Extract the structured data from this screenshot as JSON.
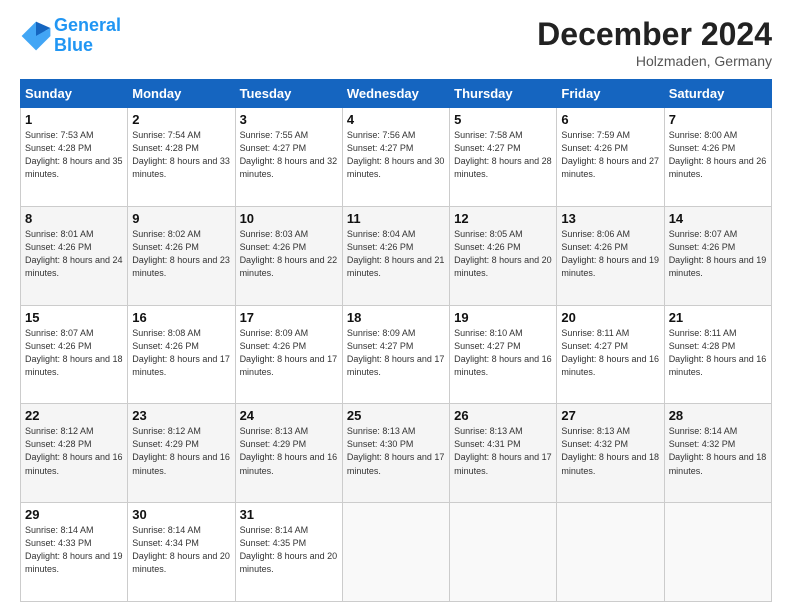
{
  "header": {
    "logo_line1": "General",
    "logo_line2": "Blue",
    "month": "December 2024",
    "location": "Holzmaden, Germany"
  },
  "weekdays": [
    "Sunday",
    "Monday",
    "Tuesday",
    "Wednesday",
    "Thursday",
    "Friday",
    "Saturday"
  ],
  "weeks": [
    [
      {
        "day": "1",
        "sunrise": "Sunrise: 7:53 AM",
        "sunset": "Sunset: 4:28 PM",
        "daylight": "Daylight: 8 hours and 35 minutes."
      },
      {
        "day": "2",
        "sunrise": "Sunrise: 7:54 AM",
        "sunset": "Sunset: 4:28 PM",
        "daylight": "Daylight: 8 hours and 33 minutes."
      },
      {
        "day": "3",
        "sunrise": "Sunrise: 7:55 AM",
        "sunset": "Sunset: 4:27 PM",
        "daylight": "Daylight: 8 hours and 32 minutes."
      },
      {
        "day": "4",
        "sunrise": "Sunrise: 7:56 AM",
        "sunset": "Sunset: 4:27 PM",
        "daylight": "Daylight: 8 hours and 30 minutes."
      },
      {
        "day": "5",
        "sunrise": "Sunrise: 7:58 AM",
        "sunset": "Sunset: 4:27 PM",
        "daylight": "Daylight: 8 hours and 28 minutes."
      },
      {
        "day": "6",
        "sunrise": "Sunrise: 7:59 AM",
        "sunset": "Sunset: 4:26 PM",
        "daylight": "Daylight: 8 hours and 27 minutes."
      },
      {
        "day": "7",
        "sunrise": "Sunrise: 8:00 AM",
        "sunset": "Sunset: 4:26 PM",
        "daylight": "Daylight: 8 hours and 26 minutes."
      }
    ],
    [
      {
        "day": "8",
        "sunrise": "Sunrise: 8:01 AM",
        "sunset": "Sunset: 4:26 PM",
        "daylight": "Daylight: 8 hours and 24 minutes."
      },
      {
        "day": "9",
        "sunrise": "Sunrise: 8:02 AM",
        "sunset": "Sunset: 4:26 PM",
        "daylight": "Daylight: 8 hours and 23 minutes."
      },
      {
        "day": "10",
        "sunrise": "Sunrise: 8:03 AM",
        "sunset": "Sunset: 4:26 PM",
        "daylight": "Daylight: 8 hours and 22 minutes."
      },
      {
        "day": "11",
        "sunrise": "Sunrise: 8:04 AM",
        "sunset": "Sunset: 4:26 PM",
        "daylight": "Daylight: 8 hours and 21 minutes."
      },
      {
        "day": "12",
        "sunrise": "Sunrise: 8:05 AM",
        "sunset": "Sunset: 4:26 PM",
        "daylight": "Daylight: 8 hours and 20 minutes."
      },
      {
        "day": "13",
        "sunrise": "Sunrise: 8:06 AM",
        "sunset": "Sunset: 4:26 PM",
        "daylight": "Daylight: 8 hours and 19 minutes."
      },
      {
        "day": "14",
        "sunrise": "Sunrise: 8:07 AM",
        "sunset": "Sunset: 4:26 PM",
        "daylight": "Daylight: 8 hours and 19 minutes."
      }
    ],
    [
      {
        "day": "15",
        "sunrise": "Sunrise: 8:07 AM",
        "sunset": "Sunset: 4:26 PM",
        "daylight": "Daylight: 8 hours and 18 minutes."
      },
      {
        "day": "16",
        "sunrise": "Sunrise: 8:08 AM",
        "sunset": "Sunset: 4:26 PM",
        "daylight": "Daylight: 8 hours and 17 minutes."
      },
      {
        "day": "17",
        "sunrise": "Sunrise: 8:09 AM",
        "sunset": "Sunset: 4:26 PM",
        "daylight": "Daylight: 8 hours and 17 minutes."
      },
      {
        "day": "18",
        "sunrise": "Sunrise: 8:09 AM",
        "sunset": "Sunset: 4:27 PM",
        "daylight": "Daylight: 8 hours and 17 minutes."
      },
      {
        "day": "19",
        "sunrise": "Sunrise: 8:10 AM",
        "sunset": "Sunset: 4:27 PM",
        "daylight": "Daylight: 8 hours and 16 minutes."
      },
      {
        "day": "20",
        "sunrise": "Sunrise: 8:11 AM",
        "sunset": "Sunset: 4:27 PM",
        "daylight": "Daylight: 8 hours and 16 minutes."
      },
      {
        "day": "21",
        "sunrise": "Sunrise: 8:11 AM",
        "sunset": "Sunset: 4:28 PM",
        "daylight": "Daylight: 8 hours and 16 minutes."
      }
    ],
    [
      {
        "day": "22",
        "sunrise": "Sunrise: 8:12 AM",
        "sunset": "Sunset: 4:28 PM",
        "daylight": "Daylight: 8 hours and 16 minutes."
      },
      {
        "day": "23",
        "sunrise": "Sunrise: 8:12 AM",
        "sunset": "Sunset: 4:29 PM",
        "daylight": "Daylight: 8 hours and 16 minutes."
      },
      {
        "day": "24",
        "sunrise": "Sunrise: 8:13 AM",
        "sunset": "Sunset: 4:29 PM",
        "daylight": "Daylight: 8 hours and 16 minutes."
      },
      {
        "day": "25",
        "sunrise": "Sunrise: 8:13 AM",
        "sunset": "Sunset: 4:30 PM",
        "daylight": "Daylight: 8 hours and 17 minutes."
      },
      {
        "day": "26",
        "sunrise": "Sunrise: 8:13 AM",
        "sunset": "Sunset: 4:31 PM",
        "daylight": "Daylight: 8 hours and 17 minutes."
      },
      {
        "day": "27",
        "sunrise": "Sunrise: 8:13 AM",
        "sunset": "Sunset: 4:32 PM",
        "daylight": "Daylight: 8 hours and 18 minutes."
      },
      {
        "day": "28",
        "sunrise": "Sunrise: 8:14 AM",
        "sunset": "Sunset: 4:32 PM",
        "daylight": "Daylight: 8 hours and 18 minutes."
      }
    ],
    [
      {
        "day": "29",
        "sunrise": "Sunrise: 8:14 AM",
        "sunset": "Sunset: 4:33 PM",
        "daylight": "Daylight: 8 hours and 19 minutes."
      },
      {
        "day": "30",
        "sunrise": "Sunrise: 8:14 AM",
        "sunset": "Sunset: 4:34 PM",
        "daylight": "Daylight: 8 hours and 20 minutes."
      },
      {
        "day": "31",
        "sunrise": "Sunrise: 8:14 AM",
        "sunset": "Sunset: 4:35 PM",
        "daylight": "Daylight: 8 hours and 20 minutes."
      },
      null,
      null,
      null,
      null
    ]
  ]
}
